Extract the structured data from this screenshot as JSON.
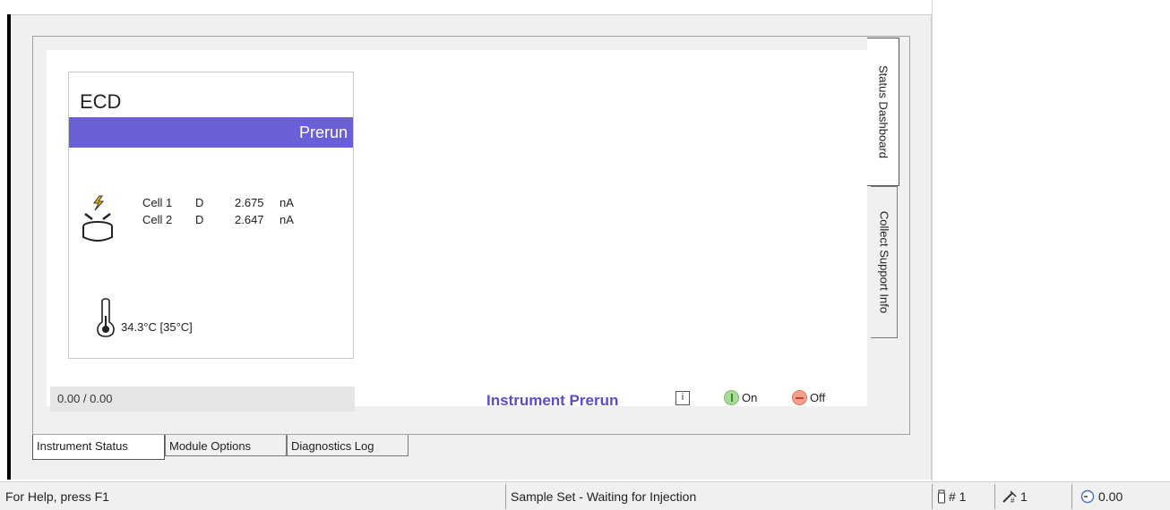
{
  "module": {
    "title": "ECD",
    "state": "Prerun",
    "state_color": "#6a5fd6",
    "cells": [
      {
        "name": "Cell 1",
        "mode": "D",
        "value": "2.675",
        "unit": "nA"
      },
      {
        "name": "Cell 2",
        "mode": "D",
        "value": "2.647",
        "unit": "nA"
      }
    ],
    "temperature": "34.3°C  [35°C]"
  },
  "dashboard": {
    "progress": "0.00 / 0.00",
    "instrument_status": "Instrument Prerun",
    "instrument_status_color": "#5a4fc4",
    "info_icon": "info-icon",
    "on_label": "On",
    "off_label": "Off"
  },
  "vertical_tabs": [
    {
      "label": "Status Dashboard"
    },
    {
      "label": "Collect Support Info"
    }
  ],
  "bottom_tabs": [
    {
      "label": "Instrument Status"
    },
    {
      "label": "Module Options"
    },
    {
      "label": "Diagnostics Log"
    }
  ],
  "statusbar": {
    "help": "For Help, press F1",
    "sample_set": "Sample Set - Waiting for Injection",
    "injection": "# 1",
    "vial": "1",
    "run_time": "0.00"
  }
}
